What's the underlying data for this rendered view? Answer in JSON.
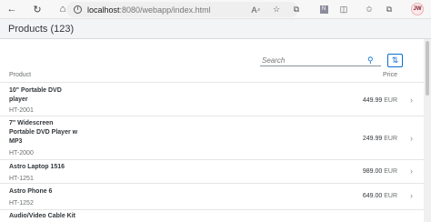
{
  "browser": {
    "url_host": "localhost",
    "url_rest": ":8080/webapp/index.html",
    "avatar_initials": "JW",
    "icons": [
      "back-icon",
      "refresh-icon",
      "home-icon",
      "info-icon",
      "read-aloud-icon",
      "favorite-icon",
      "extensions-icon",
      "app-icon",
      "split-screen-icon",
      "favorites-icon",
      "collections-icon"
    ]
  },
  "app": {
    "title": "Products (123)"
  },
  "toolbar": {
    "search_placeholder": "Search"
  },
  "table": {
    "columns": {
      "product": "Product",
      "price": "Price"
    },
    "rows": [
      {
        "name": "10\" Portable DVD player",
        "id": "HT-2001",
        "price": "449.99",
        "currency": "EUR"
      },
      {
        "name": "7\" Widescreen Portable DVD Player w MP3",
        "id": "HT-2000",
        "price": "249.99",
        "currency": "EUR"
      },
      {
        "name": "Astro Laptop 1516",
        "id": "HT-1251",
        "price": "989.00",
        "currency": "EUR"
      },
      {
        "name": "Astro Phone 6",
        "id": "HT-1252",
        "price": "649.00",
        "currency": "EUR"
      },
      {
        "name": "Audio/Video Cable Kit",
        "id": "",
        "price": "",
        "currency": ""
      }
    ]
  },
  "colors": {
    "accent": "#0a6ed1",
    "header_bg": "#f2f4f6"
  }
}
